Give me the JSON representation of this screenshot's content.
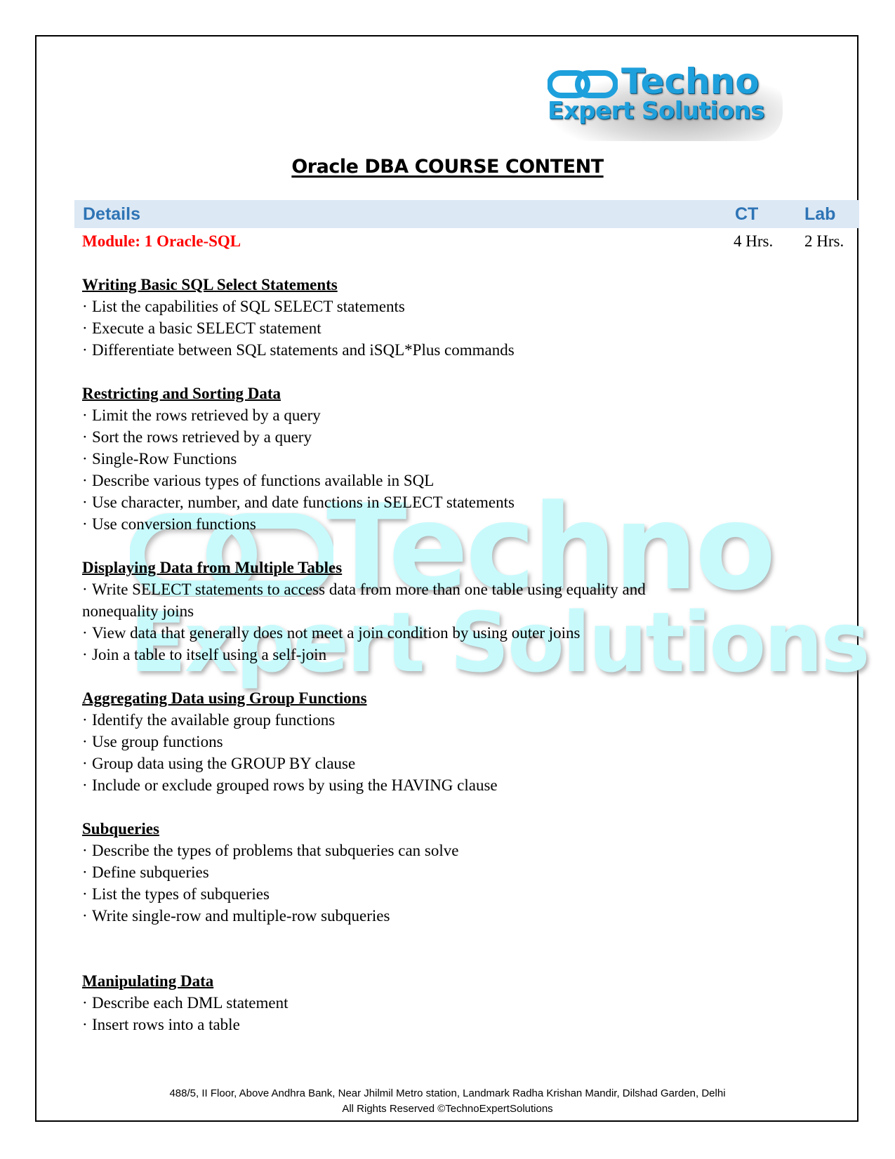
{
  "logo": {
    "line1": "Techno",
    "line2": "Expert Solutions",
    "icon": "chain-link-icon",
    "color": "#1ea0dc"
  },
  "watermark": {
    "line1": "Techno",
    "line2": "Expert Solutions",
    "icon": "chain-link-icon",
    "color": "#c8fafc"
  },
  "title": "Oracle DBA COURSE CONTENT",
  "table_header": {
    "details": "Details",
    "ct": "CT",
    "lab": "Lab",
    "color": "#2e74b5",
    "background": "#dce8f4"
  },
  "module": {
    "name": "Module: 1 Oracle-SQL",
    "ct": "4 Hrs.",
    "lab": "2 Hrs.",
    "color": "#ff0000"
  },
  "bullet": "·",
  "sections": [
    {
      "title": "Writing Basic SQL Select Statements",
      "items": [
        "List the capabilities of SQL SELECT statements",
        "Execute a basic SELECT statement",
        "Differentiate between SQL statements and iSQL*Plus commands"
      ]
    },
    {
      "title": "Restricting and Sorting Data",
      "items": [
        "Limit the rows retrieved by a query",
        "Sort the rows retrieved by a query",
        "Single-Row Functions",
        "Describe various types of functions available in SQL",
        "Use character, number, and date functions in SELECT statements",
        "Use conversion functions"
      ]
    },
    {
      "title": "Displaying Data from Multiple Tables",
      "items": [
        "Write SELECT statements to access data from more than one table using equality and nonequality joins",
        "View data that generally does not meet a join condition by using outer joins",
        "Join a table to itself using a self-join"
      ]
    },
    {
      "title": "Aggregating Data using Group Functions",
      "items": [
        "Identify the available group functions",
        "Use group functions",
        "Group data using the GROUP BY clause",
        "Include or exclude grouped rows by using the HAVING clause"
      ]
    },
    {
      "title": "Subqueries",
      "items": [
        "Describe the types of problems that subqueries can solve",
        "Define subqueries",
        "List the types of subqueries",
        "Write single-row and multiple-row subqueries"
      ]
    },
    {
      "title": "Manipulating Data",
      "items": [
        "Describe each DML statement",
        "Insert rows into a table"
      ]
    }
  ],
  "footer": {
    "address": "488/5, II Floor, Above Andhra Bank, Near Jhilmil Metro station, Landmark Radha Krishan Mandir, Dilshad Garden, Delhi",
    "copyright": "All Rights Reserved ©TechnoExpertSolutions"
  }
}
